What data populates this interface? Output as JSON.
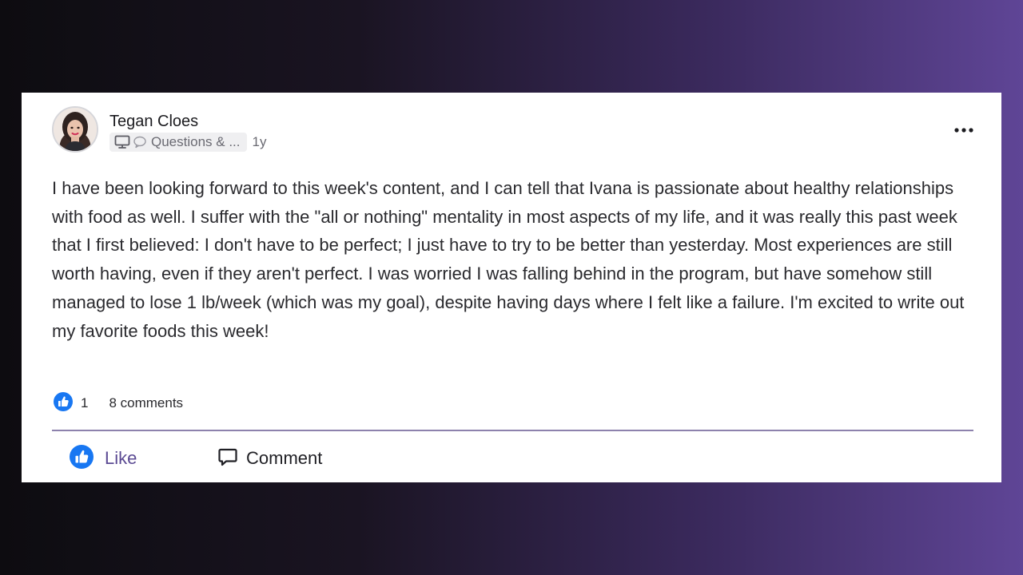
{
  "post": {
    "author": {
      "name": "Tegan Cloes"
    },
    "space_name": "Questions & ...",
    "timestamp": "1y",
    "body": "I have been looking forward to this week's content, and I can tell that Ivana is passionate about healthy relationships with food as well. I suffer with the \"all or nothing\" mentality in most aspects of my life, and it was really this past week that I first believed: I don't have to be perfect; I just have to try to be better than yesterday. Most experiences are still worth having, even if they aren't perfect. I was worried I was falling behind in the program, but have somehow still managed to lose 1 lb/week (which was my goal), despite having days where I felt like a failure. I'm excited to write out my favorite foods this week!",
    "stats": {
      "likes": "1",
      "comments": "8 comments"
    },
    "actions": {
      "like_label": "Like",
      "comment_label": "Comment"
    },
    "icons": {
      "chip_icons": [
        "monitor-icon",
        "speech-bubble-icon"
      ],
      "more": "more-horizontal-icon",
      "like": "thumbs-up-icon",
      "comment": "comment-bubble-icon"
    },
    "colors": {
      "like_blue": "#1877f2",
      "like_label": "#5b4a93",
      "divider": "#8d82ad"
    }
  }
}
